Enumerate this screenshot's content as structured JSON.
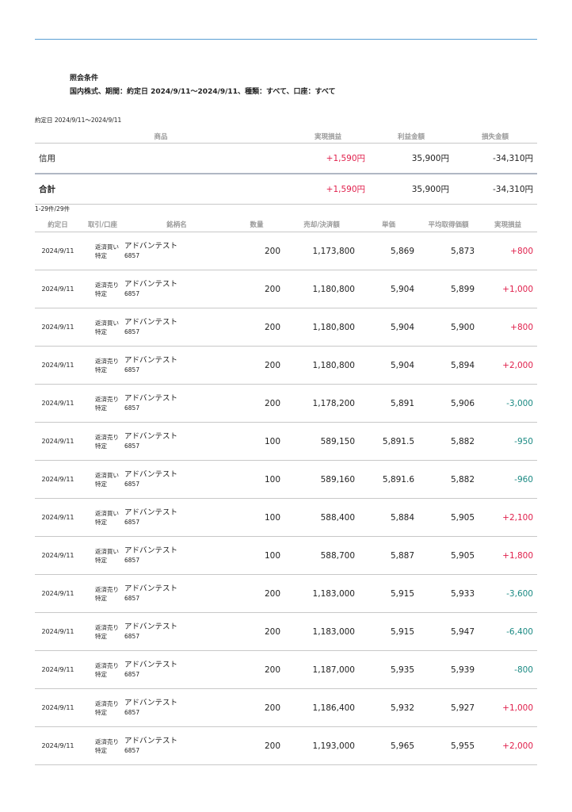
{
  "condition": {
    "title": "照会条件",
    "text": "国内株式、期間：約定日 2024/9/11〜2024/9/11、種類：すべて、口座：すべて"
  },
  "period_label": "約定日 2024/9/11〜2024/9/11",
  "summary": {
    "headers": [
      "商品",
      "実現損益",
      "利益金額",
      "損失金額"
    ],
    "rows": [
      {
        "label": "信用",
        "pnl": "+1,590円",
        "profit": "35,900円",
        "loss": "-34,310円"
      },
      {
        "label": "合計",
        "pnl": "+1,590円",
        "profit": "35,900円",
        "loss": "-34,310円"
      }
    ]
  },
  "count_label": "1-29件/29件",
  "detail": {
    "headers": [
      "約定日",
      "取引/口座",
      "銘柄名",
      "数量",
      "売却/決済額",
      "単価",
      "平均取得価額",
      "実現損益"
    ],
    "rows": [
      {
        "date": "2024/9/11",
        "trade": "返済買い",
        "account": "特定",
        "name": "アドバンテスト",
        "code": "6857",
        "qty": "200",
        "amount": "1,173,800",
        "price": "5,869",
        "avg": "5,873",
        "pnl": "+800"
      },
      {
        "date": "2024/9/11",
        "trade": "返済売り",
        "account": "特定",
        "name": "アドバンテスト",
        "code": "6857",
        "qty": "200",
        "amount": "1,180,800",
        "price": "5,904",
        "avg": "5,899",
        "pnl": "+1,000"
      },
      {
        "date": "2024/9/11",
        "trade": "返済買い",
        "account": "特定",
        "name": "アドバンテスト",
        "code": "6857",
        "qty": "200",
        "amount": "1,180,800",
        "price": "5,904",
        "avg": "5,900",
        "pnl": "+800"
      },
      {
        "date": "2024/9/11",
        "trade": "返済売り",
        "account": "特定",
        "name": "アドバンテスト",
        "code": "6857",
        "qty": "200",
        "amount": "1,180,800",
        "price": "5,904",
        "avg": "5,894",
        "pnl": "+2,000"
      },
      {
        "date": "2024/9/11",
        "trade": "返済売り",
        "account": "特定",
        "name": "アドバンテスト",
        "code": "6857",
        "qty": "200",
        "amount": "1,178,200",
        "price": "5,891",
        "avg": "5,906",
        "pnl": "-3,000"
      },
      {
        "date": "2024/9/11",
        "trade": "返済売り",
        "account": "特定",
        "name": "アドバンテスト",
        "code": "6857",
        "qty": "100",
        "amount": "589,150",
        "price": "5,891.5",
        "avg": "5,882",
        "pnl": "-950"
      },
      {
        "date": "2024/9/11",
        "trade": "返済買い",
        "account": "特定",
        "name": "アドバンテスト",
        "code": "6857",
        "qty": "100",
        "amount": "589,160",
        "price": "5,891.6",
        "avg": "5,882",
        "pnl": "-960"
      },
      {
        "date": "2024/9/11",
        "trade": "返済買い",
        "account": "特定",
        "name": "アドバンテスト",
        "code": "6857",
        "qty": "100",
        "amount": "588,400",
        "price": "5,884",
        "avg": "5,905",
        "pnl": "+2,100"
      },
      {
        "date": "2024/9/11",
        "trade": "返済買い",
        "account": "特定",
        "name": "アドバンテスト",
        "code": "6857",
        "qty": "100",
        "amount": "588,700",
        "price": "5,887",
        "avg": "5,905",
        "pnl": "+1,800"
      },
      {
        "date": "2024/9/11",
        "trade": "返済売り",
        "account": "特定",
        "name": "アドバンテスト",
        "code": "6857",
        "qty": "200",
        "amount": "1,183,000",
        "price": "5,915",
        "avg": "5,933",
        "pnl": "-3,600"
      },
      {
        "date": "2024/9/11",
        "trade": "返済売り",
        "account": "特定",
        "name": "アドバンテスト",
        "code": "6857",
        "qty": "200",
        "amount": "1,183,000",
        "price": "5,915",
        "avg": "5,947",
        "pnl": "-6,400"
      },
      {
        "date": "2024/9/11",
        "trade": "返済売り",
        "account": "特定",
        "name": "アドバンテスト",
        "code": "6857",
        "qty": "200",
        "amount": "1,187,000",
        "price": "5,935",
        "avg": "5,939",
        "pnl": "-800"
      },
      {
        "date": "2024/9/11",
        "trade": "返済売り",
        "account": "特定",
        "name": "アドバンテスト",
        "code": "6857",
        "qty": "200",
        "amount": "1,186,400",
        "price": "5,932",
        "avg": "5,927",
        "pnl": "+1,000"
      },
      {
        "date": "2024/9/11",
        "trade": "返済売り",
        "account": "特定",
        "name": "アドバンテスト",
        "code": "6857",
        "qty": "200",
        "amount": "1,193,000",
        "price": "5,965",
        "avg": "5,955",
        "pnl": "+2,000"
      }
    ]
  },
  "colors": {
    "positive": "#e0204c",
    "negative": "#1b8a83",
    "rule": "#5a9fd4"
  }
}
